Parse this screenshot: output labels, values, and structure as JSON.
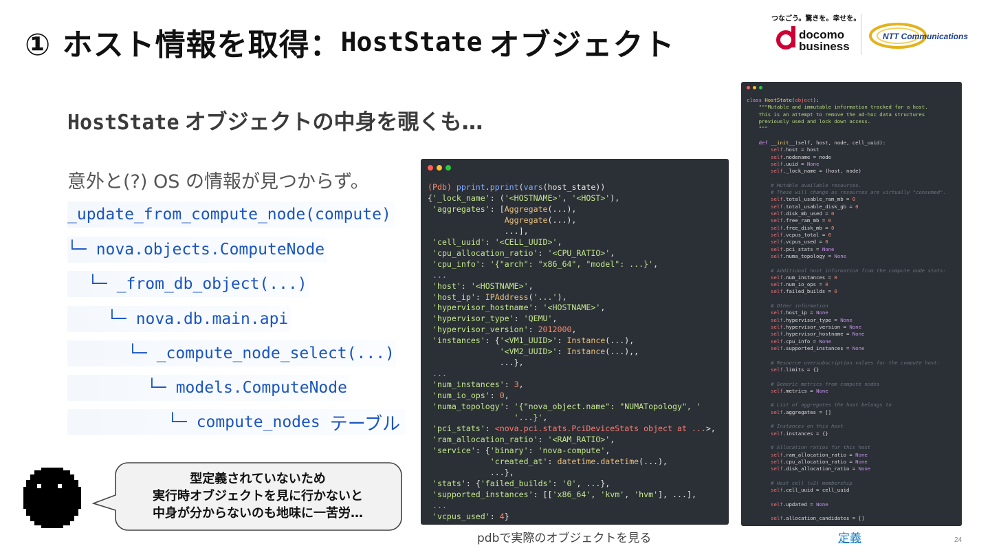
{
  "title": {
    "prefix": "① ホスト情報を取得：",
    "mono": "HostState",
    "suffix": "オブジェクト"
  },
  "logos": {
    "docomo_tagline": "つなごう。驚きを。幸せを。",
    "docomo_name_line1": "docomo",
    "docomo_name_line2": "business",
    "ntt_name": "NTT Communications"
  },
  "subtitle": {
    "mono": "HostState",
    "text": "オブジェクトの中身を覗くも…"
  },
  "intro": "意外と(?) OS の情報が見つからず。",
  "tree": [
    {
      "branch": "",
      "text": "_update_from_compute_node(compute)",
      "jp": ""
    },
    {
      "branch": "└─",
      "text": "nova.objects.ComputeNode",
      "jp": ""
    },
    {
      "branch": "└─",
      "text": "_from_db_object(...)",
      "jp": ""
    },
    {
      "branch": "└─",
      "text": "nova.db.main.api",
      "jp": ""
    },
    {
      "branch": "└─",
      "text": "_compute_node_select(...)",
      "jp": ""
    },
    {
      "branch": "└─",
      "text": "models.ComputeNode",
      "jp": ""
    },
    {
      "branch": "└─",
      "text": "compute_nodes",
      "jp": "テーブル"
    }
  ],
  "bubble": {
    "line1": "型定義されていないため",
    "line2": "実行時オブジェクトを見に行かないと",
    "line3": "中身が分からないのも地味に一苦労…"
  },
  "pdb_panel": {
    "dot_colors": [
      "#ff5f56",
      "#ffbd2e",
      "#27c93f"
    ],
    "lines": [
      "(Pdb) pprint.pprint(vars(host_state))",
      "{'_lock_name': ('<HOSTNAME>', '<HOST>'),",
      " 'aggregates': [Aggregate(...),",
      "                Aggregate(...),",
      "                ...],",
      " 'cell_uuid': '<CELL_UUID>',",
      " 'cpu_allocation_ratio': '<CPU_RATIO>',",
      " 'cpu_info': '{\"arch\": \"x86_64\", \"model\": ...}',",
      " ...",
      " 'host': '<HOSTNAME>',",
      " 'host_ip': IPAddress('...'),",
      " 'hypervisor_hostname': '<HOSTNAME>',",
      " 'hypervisor_type': 'QEMU',",
      " 'hypervisor_version': 2012000,",
      " 'instances': {'<VM1_UUID>': Instance(...),",
      "               '<VM2_UUID>': Instance(...),,",
      "               ...},",
      " ...",
      " 'num_instances': 3,",
      " 'num_io_ops': 0,",
      " 'numa_topology': '{\"nova_object.name\": \"NUMATopology\", '",
      "                  '...}',",
      " 'pci_stats': <nova.pci.stats.PciDeviceStats object at ...>,",
      " 'ram_allocation_ratio': '<RAM_RATIO>',",
      " 'service': {'binary': 'nova-compute',",
      "             'created_at': datetime.datetime(...),",
      "             ...},",
      " 'stats': {'failed_builds': '0', ...},",
      " 'supported_instances': [['x86_64', 'kvm', 'hvm'], ...],",
      " ...",
      " 'vcpus_used': 4}"
    ]
  },
  "class_panel": {
    "lines": [
      "class HostState(object):",
      "    \"\"\"Mutable and immutable information tracked for a host.",
      "    This is an attempt to remove the ad-hoc data structures",
      "    previously used and lock down access.",
      "    \"\"\"",
      "",
      "    def __init__(self, host, node, cell_uuid):",
      "        self.host = host",
      "        self.nodename = node",
      "        self.uuid = None",
      "        self._lock_name = (host, node)",
      "",
      "        # Mutable available resources.",
      "        # These will change as resources are virtually \"consumed\".",
      "        self.total_usable_ram_mb = 0",
      "        self.total_usable_disk_gb = 0",
      "        self.disk_mb_used = 0",
      "        self.free_ram_mb = 0",
      "        self.free_disk_mb = 0",
      "        self.vcpus_total = 0",
      "        self.vcpus_used = 0",
      "        self.pci_stats = None",
      "        self.numa_topology = None",
      "",
      "        # Additional host information from the compute node stats:",
      "        self.num_instances = 0",
      "        self.num_io_ops = 0",
      "        self.failed_builds = 0",
      "",
      "        # Other information",
      "        self.host_ip = None",
      "        self.hypervisor_type = None",
      "        self.hypervisor_version = None",
      "        self.hypervisor_hostname = None",
      "        self.cpu_info = None",
      "        self.supported_instances = None",
      "",
      "        # Resource oversubscription values for the compute host:",
      "        self.limits = {}",
      "",
      "        # Generic metrics from compute nodes",
      "        self.metrics = None",
      "",
      "        # List of aggregates the host belongs to",
      "        self.aggregates = []",
      "",
      "        # Instances on this host",
      "        self.instances = {}",
      "",
      "        # Allocation ratios for this host",
      "        self.ram_allocation_ratio = None",
      "        self.cpu_allocation_ratio = None",
      "        self.disk_allocation_ratio = None",
      "",
      "        # Host cell (v2) membership",
      "        self.cell_uuid = cell_uuid",
      "",
      "        self.updated = None",
      "",
      "        self.allocation_candidates = []"
    ]
  },
  "captions": {
    "pdb": "pdbで実際のオブジェクトを見る",
    "definition": "定義"
  },
  "page_number": "24"
}
